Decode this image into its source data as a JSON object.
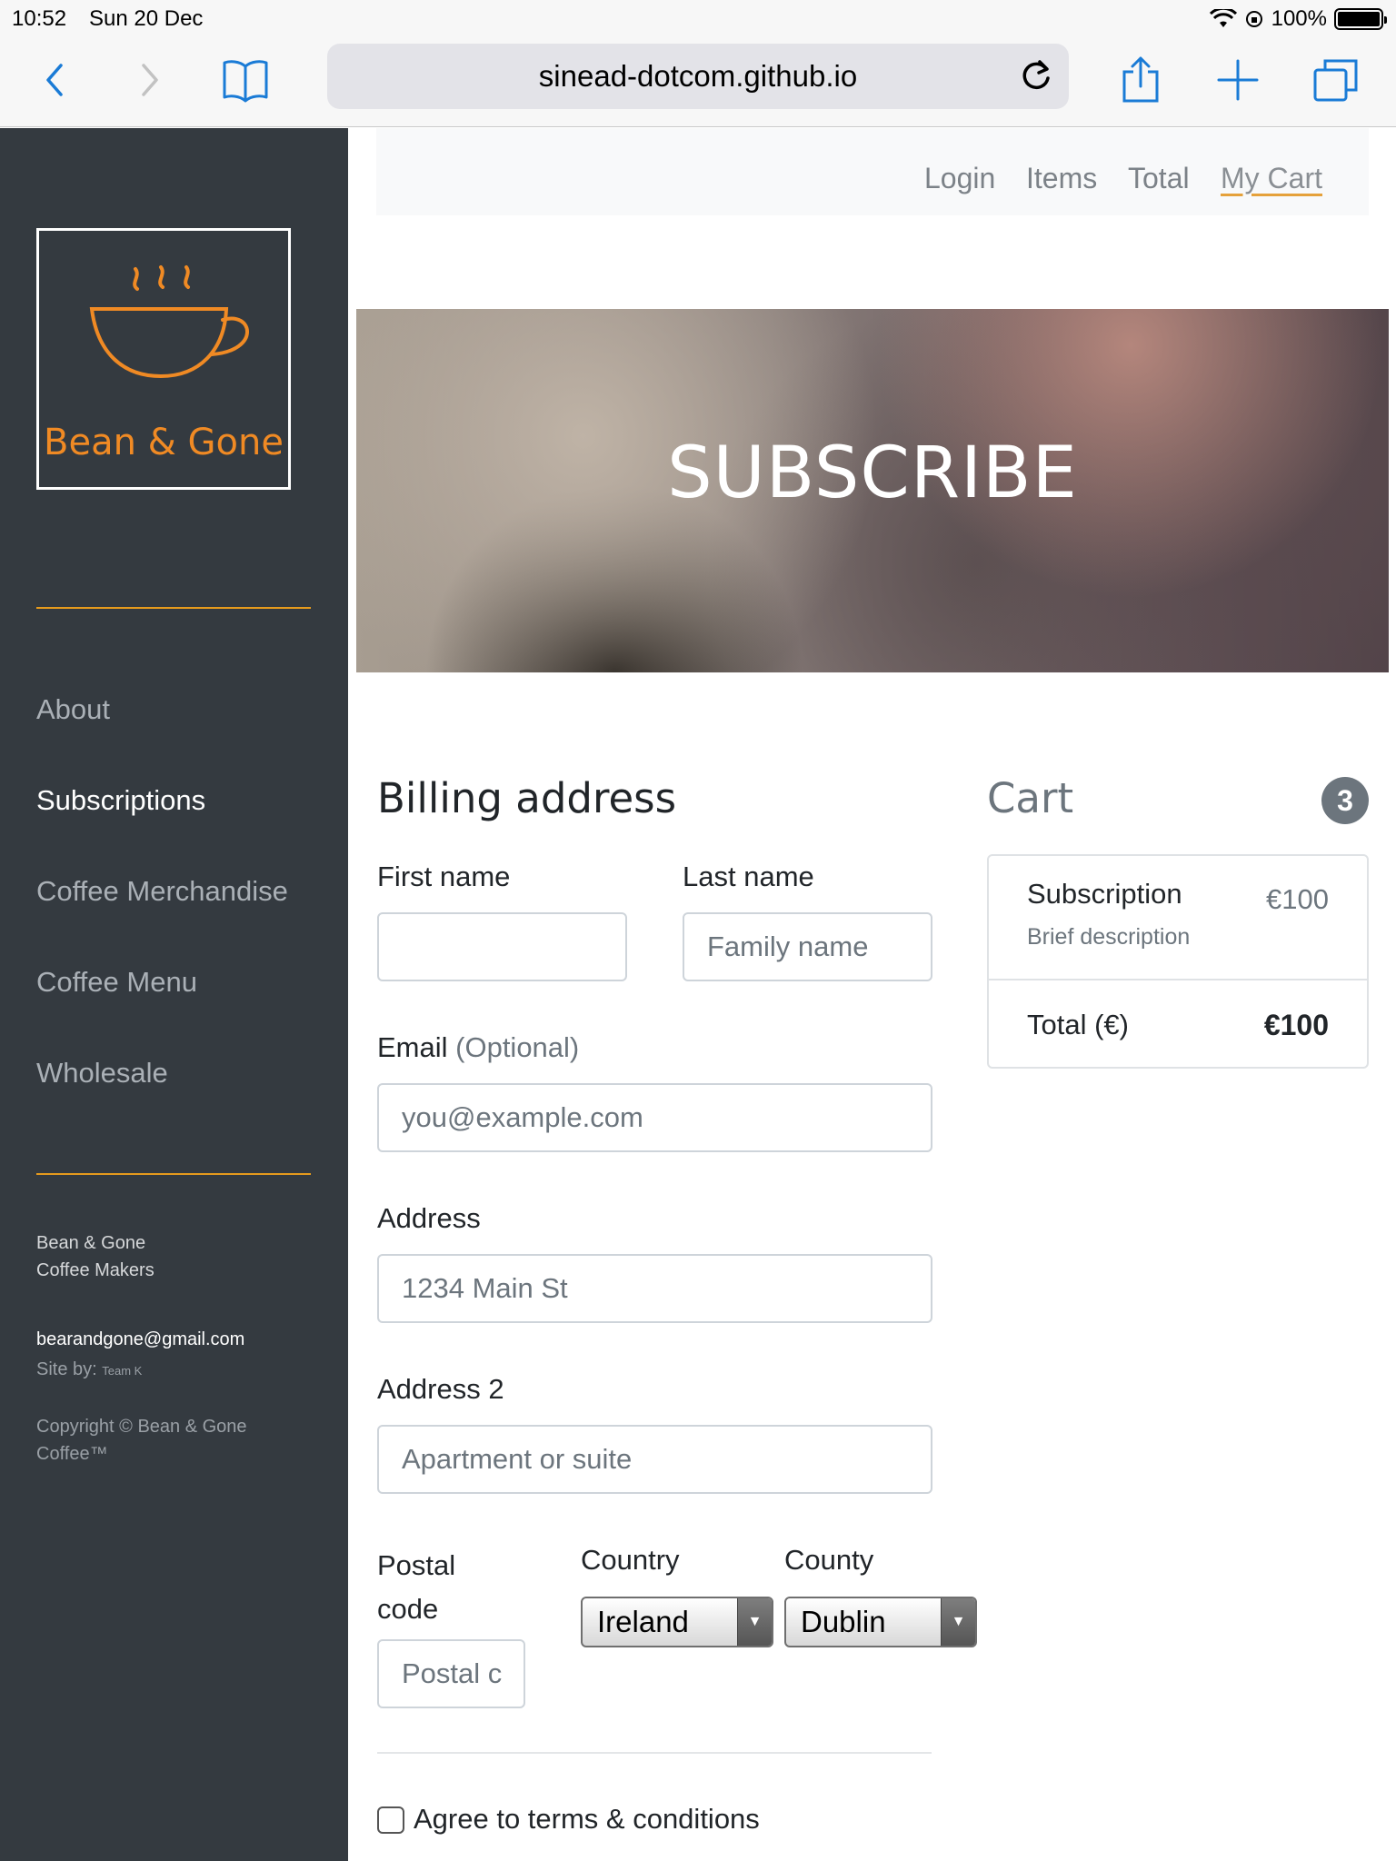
{
  "status_bar": {
    "time": "10:52",
    "date": "Sun 20 Dec",
    "battery": "100%"
  },
  "browser": {
    "url": "sinead-dotcom.github.io"
  },
  "sidebar": {
    "logo_text": "Bean & Gone",
    "items": [
      {
        "label": "About"
      },
      {
        "label": "Subscriptions"
      },
      {
        "label": "Coffee Merchandise"
      },
      {
        "label": "Coffee Menu"
      },
      {
        "label": "Wholesale"
      }
    ],
    "footer": {
      "company_line1": "Bean & Gone",
      "company_line2": "Coffee Makers",
      "email": "bearandgone@gmail.com",
      "site_by_label": "Site by:",
      "site_by_value": "Team K",
      "copyright_line1": "Copyright © Bean & Gone",
      "copyright_line2": "Coffee™"
    }
  },
  "topnav": {
    "login": "Login",
    "items": "Items",
    "total": "Total",
    "my_cart": "My Cart"
  },
  "hero": {
    "title": "SUBSCRIBE"
  },
  "billing": {
    "heading": "Billing address",
    "first_name_label": "First name",
    "first_name_value": "",
    "last_name_label": "Last name",
    "last_name_placeholder": "Family name",
    "email_label": "Email",
    "email_optional": "(Optional)",
    "email_placeholder": "you@example.com",
    "address_label": "Address",
    "address_placeholder": "1234 Main St",
    "address2_label": "Address 2",
    "address2_placeholder": "Apartment or suite",
    "postal_label_1": "Postal",
    "postal_label_2": "code",
    "postal_placeholder": "Postal c",
    "country_label": "Country",
    "country_value": "Ireland",
    "county_label": "County",
    "county_value": "Dublin",
    "terms_label": "Agree to terms & conditions"
  },
  "cart": {
    "heading": "Cart",
    "count": "3",
    "item_title": "Subscription",
    "item_desc": "Brief description",
    "item_price": "€100",
    "total_label": "Total (€)",
    "total_value": "€100"
  }
}
